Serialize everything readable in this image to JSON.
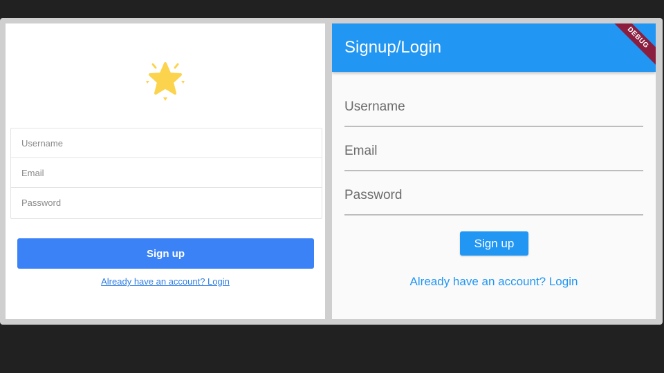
{
  "web": {
    "username_placeholder": "Username",
    "email_placeholder": "Email",
    "password_placeholder": "Password",
    "signup_label": "Sign up",
    "login_link": "Already have an account? Login",
    "accent": "#3b82f6",
    "logo_icon": "star-icon"
  },
  "app": {
    "title": "Signup/Login",
    "debug_banner": "DEBUG",
    "username_label": "Username",
    "email_label": "Email",
    "password_label": "Password",
    "signup_label": "Sign up",
    "login_link": "Already have an account? Login",
    "primary": "#2196f3"
  }
}
